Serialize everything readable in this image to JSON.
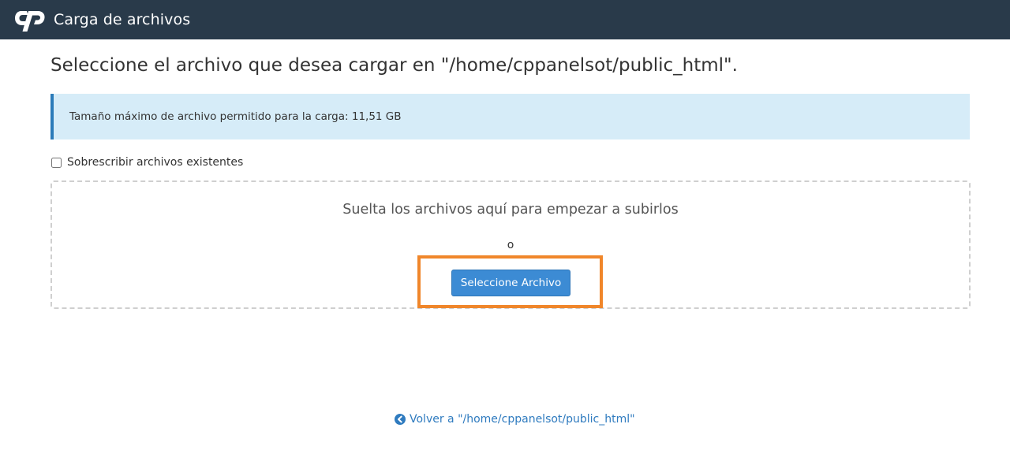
{
  "header": {
    "logo_icon": "cpanel-logo-icon",
    "title": "Carga de archivos",
    "background_color": "#293a4a"
  },
  "page": {
    "title": "Seleccione el archivo que desea cargar en \"/home/cppanelsot/public_html\"."
  },
  "alert": {
    "text": "Tamaño máximo de archivo permitido para la carga: 11,51 GB",
    "background_color": "#d6ecf8",
    "accent_color": "#2b7bb9"
  },
  "overwrite": {
    "label": "Sobrescribir archivos existentes",
    "checked": false
  },
  "dropzone": {
    "text": "Suelta los archivos aquí para empezar a subirlos",
    "or_text": "o",
    "button_label": "Seleccione Archivo",
    "button_color": "#3c8bd4",
    "highlight_color": "#f0862a"
  },
  "back": {
    "icon": "arrow-circle-left-icon",
    "label": "Volver a \"/home/cppanelsot/public_html\""
  }
}
